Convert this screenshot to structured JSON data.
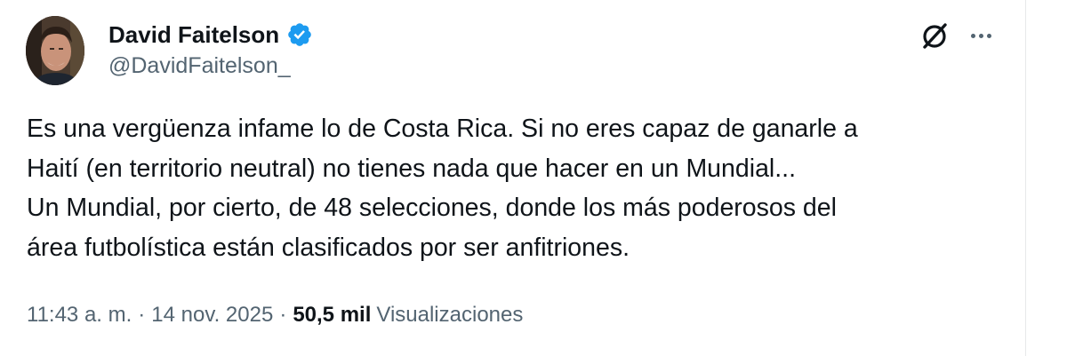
{
  "author": {
    "display_name": "David Faitelson",
    "handle": "@DavidFaitelson_",
    "verified": true,
    "avatar_icon": "profile-photo"
  },
  "icons": {
    "grok": "grok-icon",
    "more": "more-options-icon",
    "verified": "verified-badge-icon"
  },
  "tweet": {
    "text": "Es una vergüenza infame lo de Costa Rica. Si no eres capaz de ganarle a\nHaití (en territorio neutral) no tienes nada que hacer en un Mundial...\nUn Mundial, por cierto,  de 48 selecciones, donde los más poderosos del\nárea futbolística están clasificados por ser anfitriones."
  },
  "meta": {
    "time": "11:43 a. m.",
    "separator": "·",
    "date": "14 nov. 2025",
    "views_count": "50,5 mil",
    "views_label": "Visualizaciones"
  },
  "colors": {
    "verified_blue": "#1d9bf0",
    "text_primary": "#0f1419",
    "text_secondary": "#536471"
  }
}
